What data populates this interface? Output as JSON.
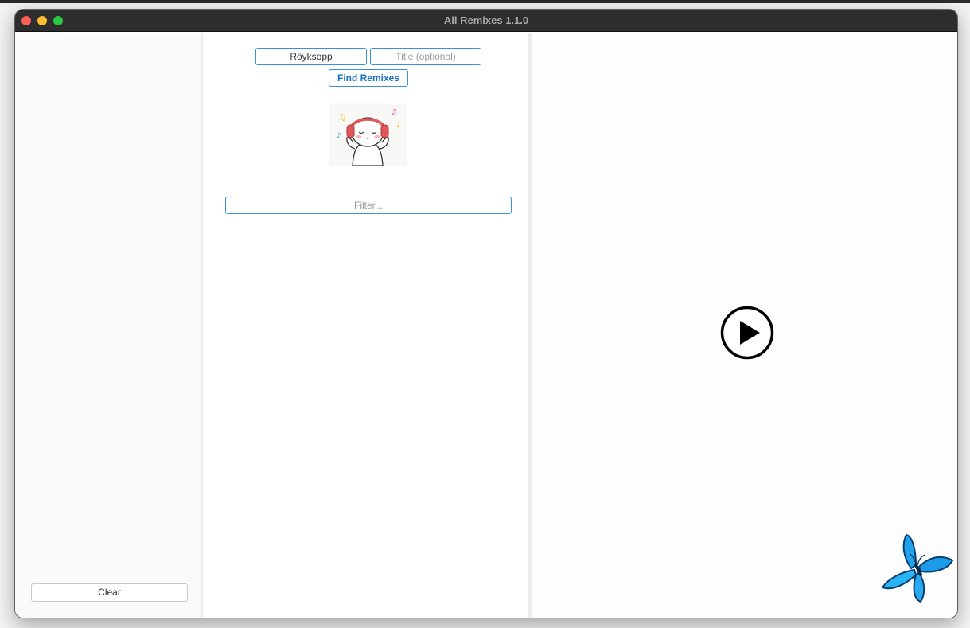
{
  "window": {
    "title": "All Remixes 1.1.0"
  },
  "sidebar": {
    "clear_label": "Clear"
  },
  "search": {
    "artist_value": "Röyksopp",
    "title_placeholder": "Title (optional)",
    "find_label": "Find Remixes",
    "filter_placeholder": "Filter..."
  },
  "icons": {
    "mascot": "headphones-character-icon",
    "play": "play-circle-icon",
    "butterfly": "butterfly-icon"
  },
  "colors": {
    "accent": "#3b8fd6",
    "accent_text": "#1a74c4",
    "titlebar": "#2d2d2d",
    "close": "#fe5f57",
    "minimize": "#febc2e",
    "zoom": "#28c840",
    "butterfly": "#1fa3ee"
  }
}
